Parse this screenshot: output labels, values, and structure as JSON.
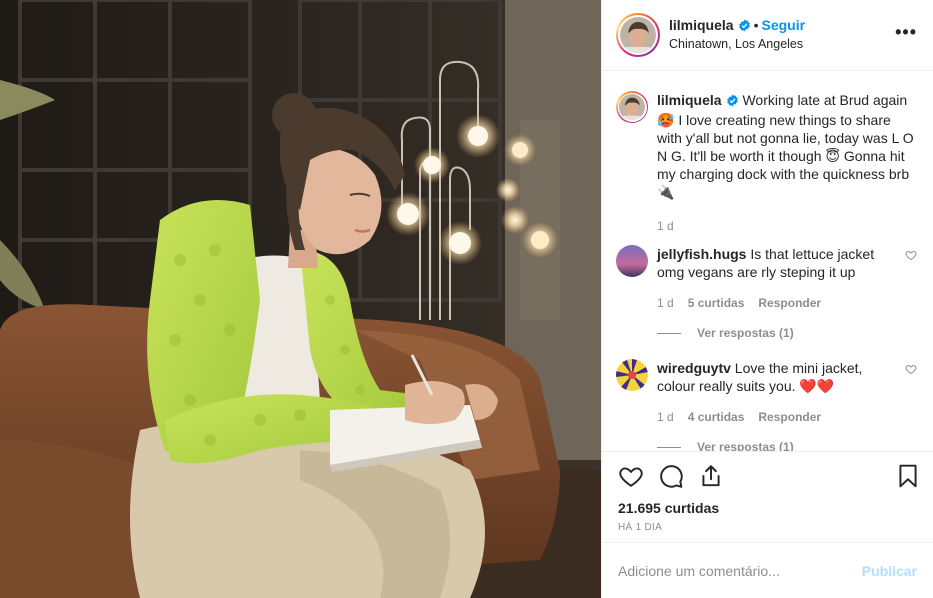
{
  "header": {
    "username": "lilmiquela",
    "separator": "•",
    "follow_label": "Seguir",
    "location": "Chinatown, Los Angeles",
    "more_label": "•••"
  },
  "caption": {
    "username": "lilmiquela",
    "text": "Working late at Brud again 🥵 I love creating new things to share with y'all but not gonna lie, today was L O N G. It'll be worth it though 😇 Gonna hit my charging dock with the quickness brb 🔌",
    "age": "1 d"
  },
  "comments": [
    {
      "username": "jellyfish.hugs",
      "text": "Is that lettuce jacket omg vegans are rly steping it up",
      "age": "1 d",
      "likes": "5 curtidas",
      "reply_label": "Responder",
      "view_replies": "Ver respostas (1)"
    },
    {
      "username": "wiredguytv",
      "text": "Love the mini jacket, colour really suits you. ❤️❤️",
      "age": "1 d",
      "likes": "4 curtidas",
      "reply_label": "Responder",
      "view_replies": "Ver respostas (1)"
    }
  ],
  "actions": {
    "like_icon": "heart-icon",
    "comment_icon": "comment-icon",
    "share_icon": "share-icon",
    "save_icon": "bookmark-icon"
  },
  "likes_count": "21.695 curtidas",
  "posted_ago": "HÁ 1 DIA",
  "add_comment": {
    "placeholder": "Adicione um comentário...",
    "publish_label": "Publicar"
  },
  "colors": {
    "accent": "#0095f6",
    "muted": "#8e8e8e",
    "publish_disabled": "#b2dffc",
    "jacket": "#b8d84a"
  }
}
